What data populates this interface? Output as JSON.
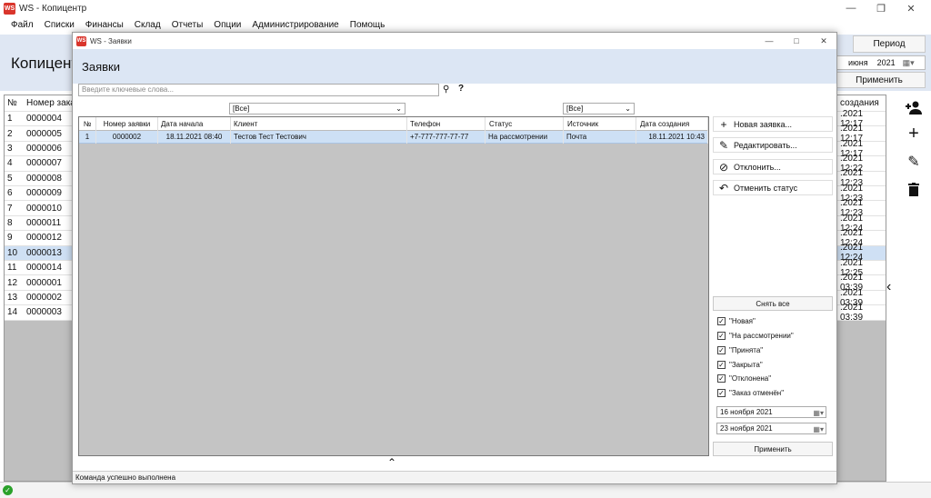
{
  "main": {
    "title": "WS - Копицентр",
    "app_icon": "WS",
    "menu": [
      "Файл",
      "Списки",
      "Финансы",
      "Склад",
      "Отчеты",
      "Опции",
      "Администрирование",
      "Помощь"
    ],
    "heading": "Копицент",
    "period_label": "Период",
    "period_month": "июня",
    "period_year": "2021",
    "apply_label": "Применить",
    "left_grid": {
      "headers": [
        "№",
        "Номер зака"
      ],
      "rows": [
        [
          "1",
          "0000004"
        ],
        [
          "2",
          "0000005"
        ],
        [
          "3",
          "0000006"
        ],
        [
          "4",
          "0000007"
        ],
        [
          "5",
          "0000008"
        ],
        [
          "6",
          "0000009"
        ],
        [
          "7",
          "0000010"
        ],
        [
          "8",
          "0000011"
        ],
        [
          "9",
          "0000012"
        ],
        [
          "10",
          "0000013"
        ],
        [
          "11",
          "0000014"
        ],
        [
          "12",
          "0000001"
        ],
        [
          "13",
          "0000002"
        ],
        [
          "14",
          "0000003"
        ]
      ],
      "selected_row": 9
    },
    "right_grid": {
      "header": "создания",
      "rows": [
        ".2021 12:17",
        ".2021 12:17",
        ".2021 12:17",
        ".2021 12:22",
        ".2021 12:23",
        ".2021 12:23",
        ".2021 12:23",
        ".2021 12:24",
        ".2021 12:24",
        ".2021 12:24",
        ".2021 12:25",
        ".2021 03:39",
        ".2021 03:39",
        ".2021 03:39"
      ]
    },
    "tools": [
      "add-user-icon",
      "plus-icon",
      "pencil-icon",
      "trash-icon"
    ],
    "collapse_icon": "chevron-left-icon",
    "status_icon": "check-circle-icon"
  },
  "dialog": {
    "title": "WS - Заявки",
    "heading": "Заявки",
    "search_placeholder": "Введите ключевые слова...",
    "help": "?",
    "filter_client": "[Все]",
    "filter_source": "[Все]",
    "columns": [
      "№",
      "Номер заявки",
      "Дата начала",
      "Клиент",
      "Телефон",
      "Статус",
      "Источник",
      "Дата создания"
    ],
    "rows": [
      [
        "1",
        "0000002",
        "18.11.2021 08:40",
        "Тестов Тест Тестович",
        "+7-777-777-77-77",
        "На рассмотрении",
        "Почта",
        "18.11.2021 10:43"
      ]
    ],
    "actions": [
      {
        "icon": "plus-icon",
        "label": "Новая заявка..."
      },
      {
        "icon": "pencil-icon",
        "label": "Редактировать..."
      },
      {
        "icon": "cancel-icon",
        "label": "Отклонить..."
      },
      {
        "icon": "undo-icon",
        "label": "Отменить статус"
      }
    ],
    "clear_all": "Снять все",
    "statuses": [
      "\"Новая\"",
      "\"На рассмотрении\"",
      "\"Принята\"",
      "\"Закрыта\"",
      "\"Отклонена\"",
      "\"Заказ отменён\""
    ],
    "date_from": "16  ноября  2021",
    "date_to": "23  ноября  2021",
    "apply_label": "Применить",
    "expand_icon": "chevron-up-icon",
    "status_text": "Команда успешно выполнена"
  }
}
